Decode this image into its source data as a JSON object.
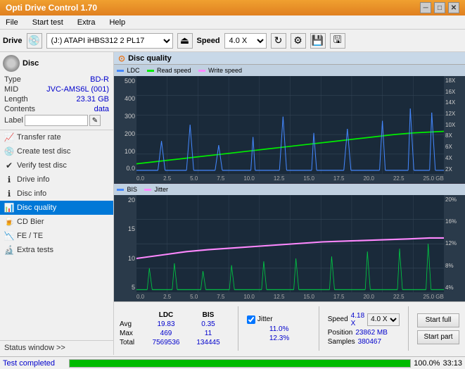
{
  "app": {
    "title": "Opti Drive Control 1.70",
    "window_controls": [
      "minimize",
      "maximize",
      "close"
    ]
  },
  "menu": {
    "items": [
      "File",
      "Start test",
      "Extra",
      "Help"
    ]
  },
  "toolbar": {
    "drive_label": "Drive",
    "drive_value": "(J:) ATAPI iHBS312  2 PL17",
    "speed_label": "Speed",
    "speed_value": "4.0 X"
  },
  "disc": {
    "section_label": "Disc",
    "type_label": "Type",
    "type_value": "BD-R",
    "mid_label": "MID",
    "mid_value": "JVC-AMS6L (001)",
    "length_label": "Length",
    "length_value": "23.31 GB",
    "contents_label": "Contents",
    "contents_value": "data",
    "label_label": "Label"
  },
  "nav": {
    "items": [
      {
        "id": "transfer-rate",
        "label": "Transfer rate"
      },
      {
        "id": "create-test-disc",
        "label": "Create test disc"
      },
      {
        "id": "verify-test-disc",
        "label": "Verify test disc"
      },
      {
        "id": "drive-info",
        "label": "Drive info"
      },
      {
        "id": "disc-info",
        "label": "Disc info"
      },
      {
        "id": "disc-quality",
        "label": "Disc quality",
        "active": true
      },
      {
        "id": "cd-bier",
        "label": "CD Bier"
      },
      {
        "id": "fe-te",
        "label": "FE / TE"
      },
      {
        "id": "extra-tests",
        "label": "Extra tests"
      }
    ]
  },
  "status_window": {
    "label": "Status window >>"
  },
  "disc_quality": {
    "title": "Disc quality",
    "chart1": {
      "legend": [
        {
          "label": "LDC",
          "color": "#4444ff"
        },
        {
          "label": "Read speed",
          "color": "#00cc00"
        },
        {
          "label": "Write speed",
          "color": "#ff44ff"
        }
      ],
      "y_left": [
        "500",
        "400",
        "300",
        "200",
        "100",
        "0.0"
      ],
      "y_right": [
        "18X",
        "16X",
        "14X",
        "12X",
        "10X",
        "8X",
        "6X",
        "4X",
        "2X"
      ],
      "x_labels": [
        "0.0",
        "2.5",
        "5.0",
        "7.5",
        "10.0",
        "12.5",
        "15.0",
        "17.5",
        "20.0",
        "22.5",
        "25.0 GB"
      ]
    },
    "chart2": {
      "legend": [
        {
          "label": "BIS",
          "color": "#4444ff"
        },
        {
          "label": "Jitter",
          "color": "#ff44ff"
        }
      ],
      "y_left": [
        "20",
        "15",
        "10",
        "5"
      ],
      "y_right": [
        "20%",
        "16%",
        "12%",
        "8%",
        "4%"
      ],
      "x_labels": [
        "0.0",
        "2.5",
        "5.0",
        "7.5",
        "10.0",
        "12.5",
        "15.0",
        "17.5",
        "20.0",
        "22.5",
        "25.0 GB"
      ]
    }
  },
  "stats": {
    "col_headers": [
      "",
      "LDC",
      "BIS",
      "",
      "Jitter",
      "Speed",
      ""
    ],
    "avg_label": "Avg",
    "avg_ldc": "19.83",
    "avg_bis": "0.35",
    "avg_jitter": "11.0%",
    "max_label": "Max",
    "max_ldc": "469",
    "max_bis": "11",
    "max_jitter": "12.3%",
    "total_label": "Total",
    "total_ldc": "7569536",
    "total_bis": "134445",
    "speed_label": "Speed",
    "speed_value": "4.18 X",
    "speed_select": "4.0 X",
    "position_label": "Position",
    "position_value": "23862 MB",
    "samples_label": "Samples",
    "samples_value": "380467",
    "jitter_checked": true,
    "btn_start_full": "Start full",
    "btn_start_part": "Start part"
  },
  "statusbar": {
    "status_text": "Test completed",
    "progress_percent": "100.0%",
    "time": "33:13"
  },
  "colors": {
    "title_bar_bg": "#e8821e",
    "active_nav_bg": "#0078d7",
    "ldc_color": "#4488ff",
    "read_speed_color": "#00ee00",
    "write_speed_color": "#ff88ff",
    "bis_color": "#4488ff",
    "jitter_color": "#ff88ff"
  }
}
